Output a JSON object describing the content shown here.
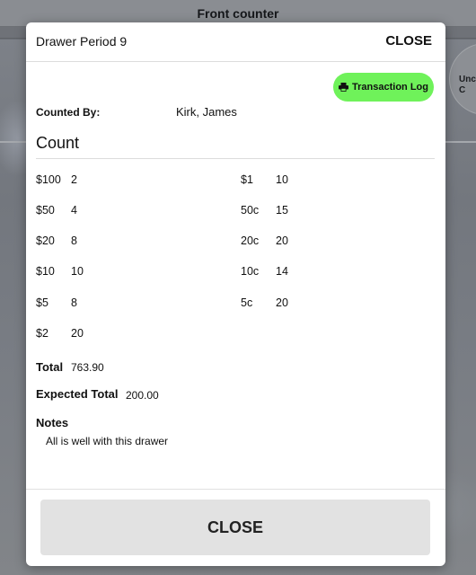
{
  "background": {
    "title": "Front counter",
    "side_badge": "Unc\nC"
  },
  "modal": {
    "title": "Drawer Period 9",
    "header_close": "CLOSE",
    "transaction_log": {
      "label": "Transaction Log",
      "icon": "printer-icon"
    },
    "counted_by_label": "Counted By:",
    "counted_by_value": "Kirk, James",
    "count_heading": "Count",
    "denominations_left": [
      {
        "denom": "$100",
        "qty": "2"
      },
      {
        "denom": "$50",
        "qty": "4"
      },
      {
        "denom": "$20",
        "qty": "8"
      },
      {
        "denom": "$10",
        "qty": "10"
      },
      {
        "denom": "$5",
        "qty": "8"
      },
      {
        "denom": "$2",
        "qty": "20"
      }
    ],
    "denominations_right": [
      {
        "denom": "$1",
        "qty": "10"
      },
      {
        "denom": "50c",
        "qty": "15"
      },
      {
        "denom": "20c",
        "qty": "20"
      },
      {
        "denom": "10c",
        "qty": "14"
      },
      {
        "denom": "5c",
        "qty": "20"
      }
    ],
    "total_label": "Total",
    "total_value": "763.90",
    "expected_label": "Expected Total",
    "expected_value": "200.00",
    "notes_label": "Notes",
    "notes_text": "All is well with this drawer",
    "footer_close": "CLOSE"
  },
  "colors": {
    "accent_green": "#6ff25a",
    "footer_button": "#e2e2e2",
    "overlay": "#6b6f76"
  }
}
